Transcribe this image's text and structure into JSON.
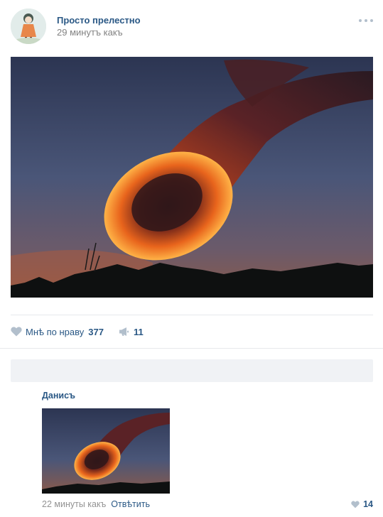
{
  "post": {
    "author": "Просто прелестно",
    "time": "29 минутъ какъ",
    "more_icon": "more-dots-icon"
  },
  "actions": {
    "like_label": "Мнѣ по нраву",
    "like_count": "377",
    "share_count": "11",
    "like_icon": "heart-icon",
    "share_icon": "megaphone-icon"
  },
  "comment": {
    "author": "Данисъ",
    "time": "22 минуты какъ",
    "reply_label": "Отвѣтить",
    "like_count": "14"
  },
  "colors": {
    "link": "#2a5885",
    "muted": "#828282",
    "icon": "#b2bfcc",
    "input_bg": "#f0f2f5"
  }
}
